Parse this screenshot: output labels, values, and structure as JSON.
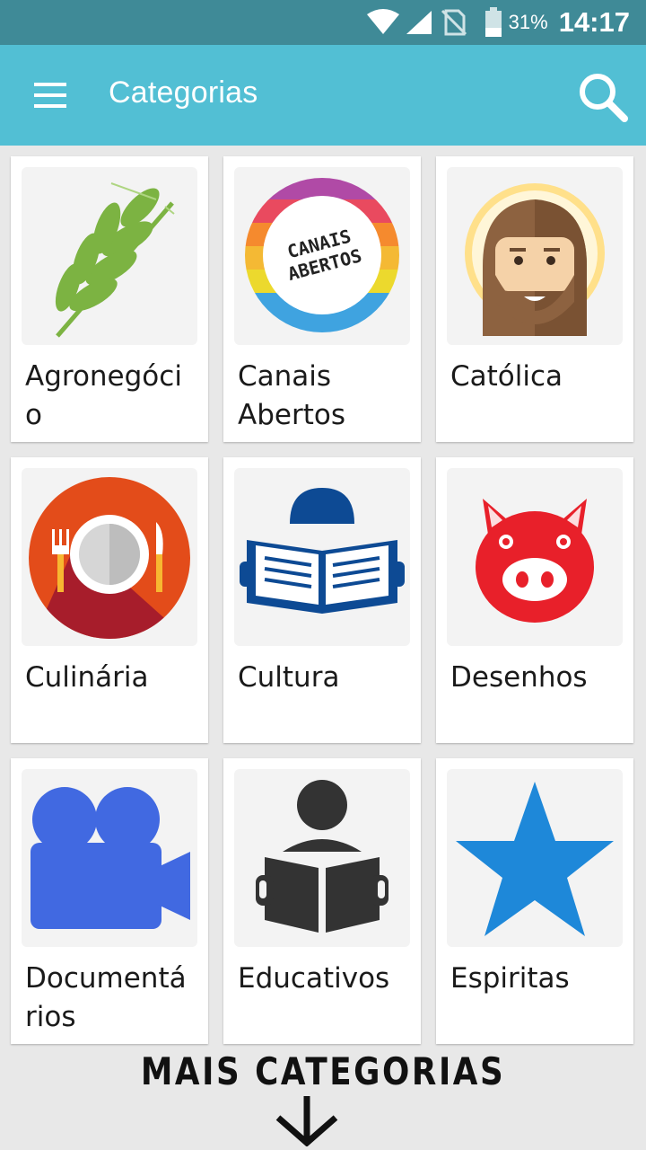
{
  "status": {
    "battery": "31%",
    "time": "14:17"
  },
  "app_bar": {
    "title": "Categorias",
    "menu_icon": "hamburger-menu-icon",
    "search_icon": "search-icon"
  },
  "categories": [
    {
      "label": "Agronegócio",
      "icon": "wheat-icon"
    },
    {
      "label": "Canais Abertos",
      "icon": "canais-abertos-logo"
    },
    {
      "label": "Católica",
      "icon": "jesus-face-icon"
    },
    {
      "label": "Culinária",
      "icon": "plate-cutlery-icon"
    },
    {
      "label": "Cultura",
      "icon": "person-reading-book-icon"
    },
    {
      "label": "Desenhos",
      "icon": "pig-face-icon"
    },
    {
      "label": "Documentários",
      "icon": "video-camera-icon"
    },
    {
      "label": "Educativos",
      "icon": "person-reading-icon"
    },
    {
      "label": "Espiritas",
      "icon": "star-icon"
    }
  ],
  "canais_logo_text": [
    "CANAIS",
    "ABERTOS"
  ],
  "more": {
    "label": "MAIS CATEGORIAS",
    "icon": "arrow-down-icon"
  },
  "colors": {
    "status_bar": "#3f8a97",
    "app_bar": "#52bfd4",
    "background": "#e8e8e8"
  }
}
